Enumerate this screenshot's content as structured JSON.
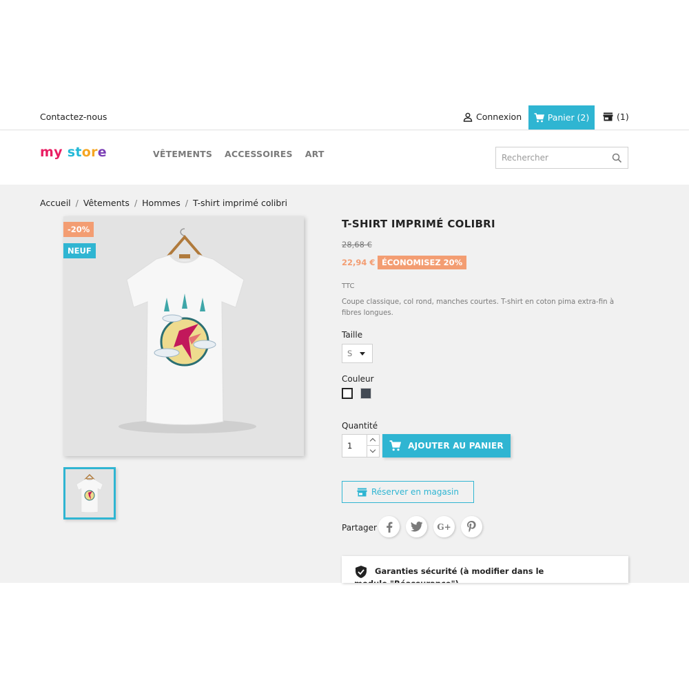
{
  "header": {
    "contact": "Contactez-nous",
    "login": "Connexion",
    "cart": "Panier (2)",
    "store_count": "(1)",
    "logo": {
      "part1": "my",
      "part2": " st",
      "part3": "or",
      "part4": "e"
    },
    "nav": [
      "VÊTEMENTS",
      "ACCESSOIRES",
      "ART"
    ],
    "search_placeholder": "Rechercher"
  },
  "breadcrumb": [
    "Accueil",
    "Vêtements",
    "Hommes",
    "T-shirt imprimé colibri"
  ],
  "product": {
    "badge_discount": "-20%",
    "badge_new": "NEUF",
    "title": "T-SHIRT IMPRIMÉ COLIBRI",
    "old_price": "28,68 €",
    "price": "22,94 €",
    "save_label": "ÉCONOMISEZ 20%",
    "tax_label": "TTC",
    "description": "Coupe classique, col rond, manches courtes. T-shirt en coton pima extra-fin à fibres longues.",
    "size_label": "Taille",
    "size_value": "S",
    "color_label": "Couleur",
    "colors": [
      "#ffffff",
      "#434a54"
    ],
    "quantity_label": "Quantité",
    "quantity_value": "1",
    "add_to_cart": "AJOUTER AU PANIER",
    "reserve": "Réserver en magasin",
    "share_label": "Partager",
    "reassurance": "Garanties sécurité (à modifier dans le module \"Réassurance\")"
  },
  "colors": {
    "accent": "#2fb5d2",
    "discount": "#f39d72",
    "background": "#f1f1f1"
  }
}
